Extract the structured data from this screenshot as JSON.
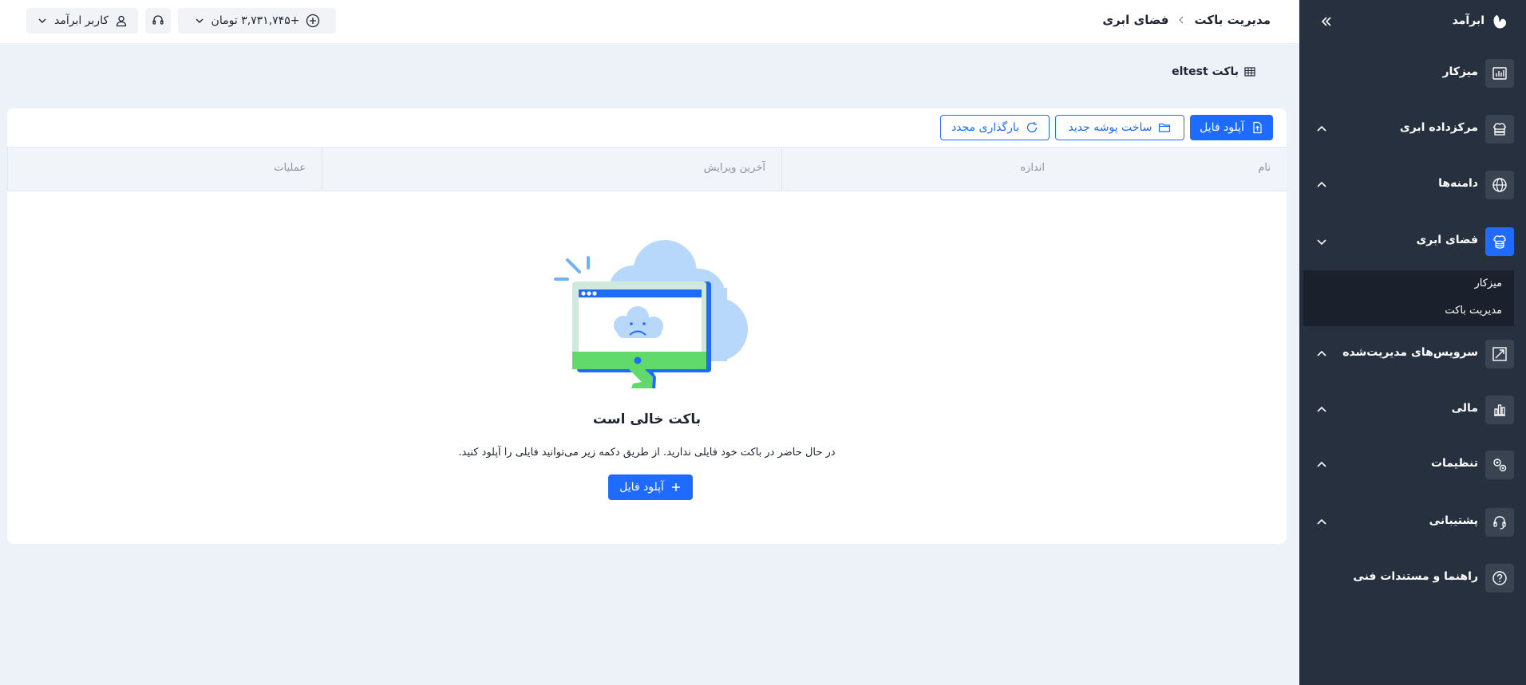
{
  "brand": {
    "name": "ابرآمد"
  },
  "sidebar": {
    "items": [
      {
        "label": "میزکار",
        "icon": "dashboard-icon"
      },
      {
        "label": "مرکزداده ابری",
        "icon": "datacenter-icon"
      },
      {
        "label": "دامنه‌ها",
        "icon": "globe-icon"
      },
      {
        "label": "فضای ابری",
        "icon": "cloud-storage-icon"
      },
      {
        "label": "سرویس‌های مدیریت‌شده",
        "icon": "managed-services-icon"
      },
      {
        "label": "مالی",
        "icon": "finance-icon"
      },
      {
        "label": "تنظیمات",
        "icon": "settings-icon"
      },
      {
        "label": "پشتیبانی",
        "icon": "headset-icon"
      },
      {
        "label": "راهنما و مستندات فنی",
        "icon": "help-icon"
      }
    ],
    "subitems": [
      {
        "label": "میزکار"
      },
      {
        "label": "مدیریت باکت"
      }
    ]
  },
  "header": {
    "breadcrumb": [
      "فضای ابری",
      "مدیریت باکت"
    ],
    "balance": "+۳,۷۳۱,۷۴۵ تومان",
    "user": "کاربر ابرآمد"
  },
  "bucket": {
    "title": "باکت eltest"
  },
  "toolbar": {
    "upload_label": "آپلود فایل",
    "new_folder_label": "ساخت پوشه جدید",
    "reload_label": "بارگذاری مجدد"
  },
  "table": {
    "columns": [
      "نام",
      "اندازه",
      "آخرین ویرایش",
      "عملیات"
    ]
  },
  "empty": {
    "title": "باکت خالی است",
    "description": "در حال حاضر در باکت خود فایلی ندارید. از طریق دکمه زیر می‌توانید فایلی را آپلود کنید.",
    "button_label": "آپلود فایل"
  },
  "colors": {
    "sidebar_bg": "#27303e",
    "accent": "#1f6bff",
    "page_bg": "#edf1f8"
  }
}
